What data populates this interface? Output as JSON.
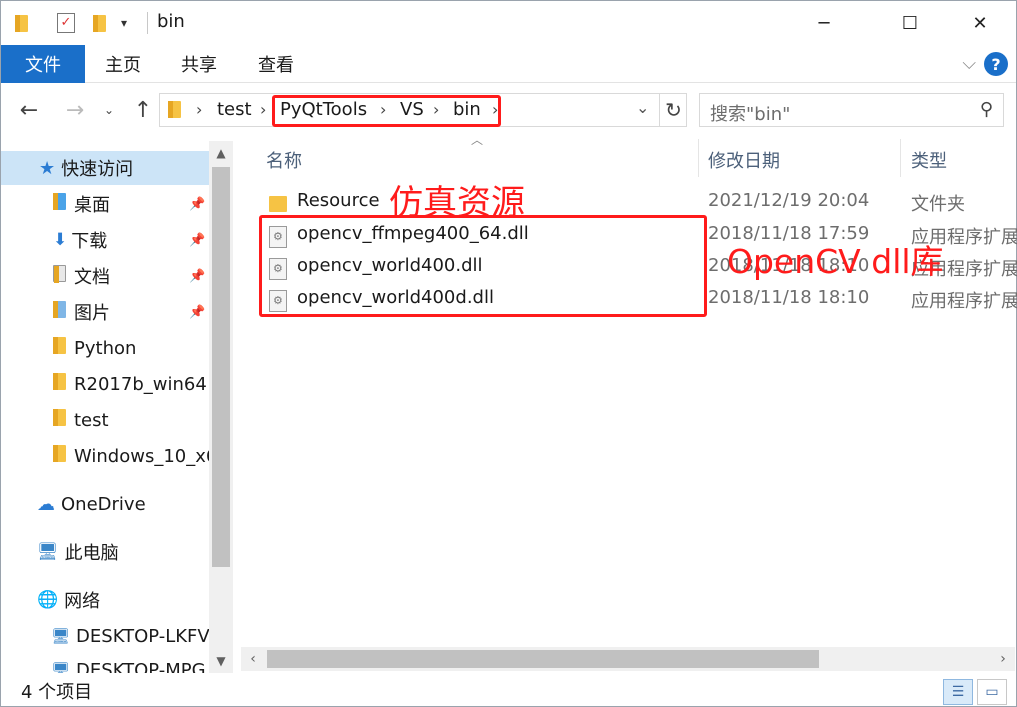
{
  "window": {
    "title": "bin",
    "minimize": "─",
    "maximize": "☐",
    "close": "✕"
  },
  "ribbon": {
    "tabs": [
      "文件",
      "主页",
      "共享",
      "查看"
    ],
    "help": "?"
  },
  "address": {
    "crumbs": [
      "test",
      "PyQtTools",
      "VS",
      "bin"
    ],
    "search_placeholder": "搜索\"bin\""
  },
  "nav_pane": {
    "items": [
      {
        "label": "快速访问",
        "kind": "quick-access",
        "selected": true
      },
      {
        "label": "桌面",
        "kind": "folder",
        "pinned": true
      },
      {
        "label": "下载",
        "kind": "folder",
        "pinned": true
      },
      {
        "label": "文档",
        "kind": "folder",
        "pinned": true
      },
      {
        "label": "图片",
        "kind": "folder",
        "pinned": true
      },
      {
        "label": "Python",
        "kind": "folder"
      },
      {
        "label": "R2017b_win64",
        "kind": "folder"
      },
      {
        "label": "test",
        "kind": "folder"
      },
      {
        "label": "Windows_10_x6",
        "kind": "folder"
      },
      {
        "label": "OneDrive",
        "kind": "cloud"
      },
      {
        "label": "此电脑",
        "kind": "pc"
      },
      {
        "label": "网络",
        "kind": "network"
      },
      {
        "label": "DESKTOP-LKFV",
        "kind": "computer"
      },
      {
        "label": "DESKTOP-MPG",
        "kind": "computer"
      }
    ]
  },
  "columns": {
    "name": "名称",
    "date": "修改日期",
    "type": "类型"
  },
  "files": [
    {
      "name": "Resource",
      "date": "2021/12/19 20:04",
      "type": "文件夹",
      "icon": "folder-icon"
    },
    {
      "name": "opencv_ffmpeg400_64.dll",
      "date": "2018/11/18 17:59",
      "type": "应用程序扩展",
      "icon": "dll-icon"
    },
    {
      "name": "opencv_world400.dll",
      "date": "2018/11/18 18:10",
      "type": "应用程序扩展",
      "icon": "dll-icon"
    },
    {
      "name": "opencv_world400d.dll",
      "date": "2018/11/18 18:10",
      "type": "应用程序扩展",
      "icon": "dll-icon"
    }
  ],
  "annotations": {
    "resource_note": "仿真资源",
    "dll_note": "OpenCV dll库"
  },
  "status": {
    "item_count": "4 个项目"
  },
  "colors": {
    "accent": "#1a6fc9",
    "selection": "#cce4f7",
    "annotation": "#ff1b1b"
  }
}
